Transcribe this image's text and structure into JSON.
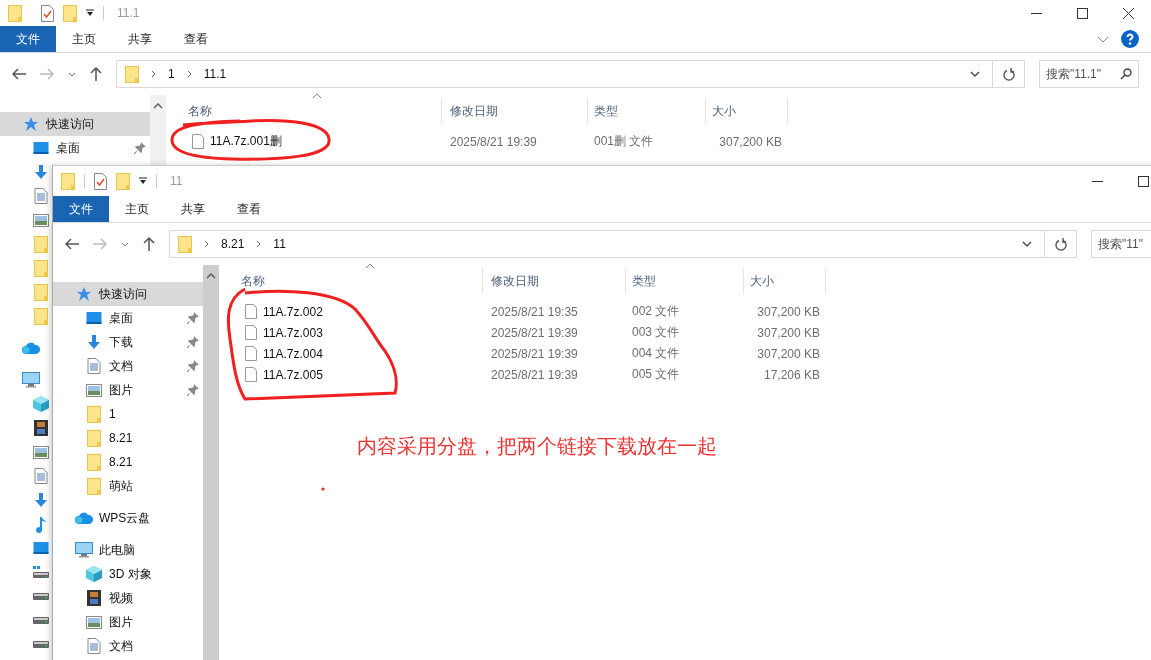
{
  "windows": [
    {
      "title": "11.1",
      "caption_buttons": [
        {
          "kind": "minimize"
        },
        {
          "kind": "maximize"
        },
        {
          "kind": "close"
        }
      ],
      "ribbon_tabs": [
        {
          "label": "文件",
          "selected": true
        },
        {
          "label": "主页",
          "selected": false
        },
        {
          "label": "共享",
          "selected": false
        },
        {
          "label": "查看",
          "selected": false
        }
      ],
      "ribbon_controls": [
        {
          "kind": "expand"
        },
        {
          "kind": "help"
        }
      ],
      "breadcrumb": [
        "1",
        "11.1"
      ],
      "search": {
        "placeholder": "搜索\"11.1\""
      },
      "columns": [
        "名称",
        "修改日期",
        "类型",
        "大小"
      ],
      "files": [
        {
          "name": "11A.7z.001删",
          "modified": "2025/8/21 19:39",
          "type": "001删 文件",
          "size": "307,200 KB"
        }
      ],
      "nav": [
        {
          "kind": "quick",
          "label": "快速访问",
          "selected": true,
          "children": [
            {
              "kind": "desktop",
              "label": "桌面",
              "pinned": true,
              "selected": false
            },
            {
              "kind": "download",
              "selected": false
            },
            {
              "kind": "documents",
              "selected": false
            },
            {
              "kind": "pictures",
              "selected": false
            },
            {
              "kind": "folder",
              "selected": false
            },
            {
              "kind": "folder",
              "selected": false
            },
            {
              "kind": "folder",
              "selected": false
            },
            {
              "kind": "folder",
              "selected": false
            }
          ]
        },
        {
          "kind": "cloud",
          "selected": false
        },
        {
          "kind": "pc",
          "selected": false,
          "children": [
            {
              "kind": "cube",
              "selected": false
            },
            {
              "kind": "video",
              "selected": false
            },
            {
              "kind": "pictures",
              "selected": false
            },
            {
              "kind": "documents",
              "selected": false
            },
            {
              "kind": "download",
              "selected": false
            },
            {
              "kind": "music",
              "selected": false
            },
            {
              "kind": "desktop",
              "selected": false
            },
            {
              "kind": "windrive",
              "selected": false
            },
            {
              "kind": "drive",
              "selected": false
            },
            {
              "kind": "drive",
              "selected": false
            },
            {
              "kind": "drive",
              "selected": false
            }
          ]
        }
      ]
    },
    {
      "title": "11",
      "caption_buttons": [
        {
          "kind": "minimize"
        },
        {
          "kind": "maximize"
        }
      ],
      "ribbon_tabs": [
        {
          "label": "文件",
          "selected": true
        },
        {
          "label": "主页",
          "selected": false
        },
        {
          "label": "共享",
          "selected": false
        },
        {
          "label": "查看",
          "selected": false
        }
      ],
      "breadcrumb": [
        "8.21",
        "11"
      ],
      "search": {
        "placeholder": "搜索\"11\""
      },
      "columns": [
        "名称",
        "修改日期",
        "类型",
        "大小"
      ],
      "files": [
        {
          "name": "11A.7z.002",
          "modified": "2025/8/21 19:35",
          "type": "002 文件",
          "size": "307,200 KB"
        },
        {
          "name": "11A.7z.003",
          "modified": "2025/8/21 19:39",
          "type": "003 文件",
          "size": "307,200 KB"
        },
        {
          "name": "11A.7z.004",
          "modified": "2025/8/21 19:39",
          "type": "004 文件",
          "size": "307,200 KB"
        },
        {
          "name": "11A.7z.005",
          "modified": "2025/8/21 19:39",
          "type": "005 文件",
          "size": "17,206 KB"
        }
      ],
      "nav": [
        {
          "kind": "quick",
          "label": "快速访问",
          "selected": true,
          "children": [
            {
              "kind": "desktop",
              "label": "桌面",
              "pinned": true,
              "selected": false
            },
            {
              "kind": "download",
              "label": "下载",
              "pinned": true,
              "selected": false
            },
            {
              "kind": "documents",
              "label": "文档",
              "pinned": true,
              "selected": false
            },
            {
              "kind": "pictures",
              "label": "图片",
              "pinned": true,
              "selected": false
            },
            {
              "kind": "folder",
              "label": "1",
              "selected": false
            },
            {
              "kind": "folder",
              "label": "8.21",
              "selected": false
            },
            {
              "kind": "folder",
              "label": "8.21",
              "selected": false
            },
            {
              "kind": "folder",
              "label": "萌站",
              "selected": false
            }
          ]
        },
        {
          "kind": "cloud",
          "label": "WPS云盘",
          "selected": false
        },
        {
          "kind": "pc",
          "label": "此电脑",
          "selected": false,
          "children": [
            {
              "kind": "cube",
              "label": "3D 对象",
              "selected": false
            },
            {
              "kind": "video",
              "label": "视频",
              "selected": false
            },
            {
              "kind": "pictures",
              "label": "图片",
              "selected": false
            },
            {
              "kind": "documents",
              "label": "文档",
              "selected": false
            }
          ]
        }
      ]
    }
  ],
  "annotation": {
    "text": "内容采用分盘，把两个链接下载放在一起"
  }
}
